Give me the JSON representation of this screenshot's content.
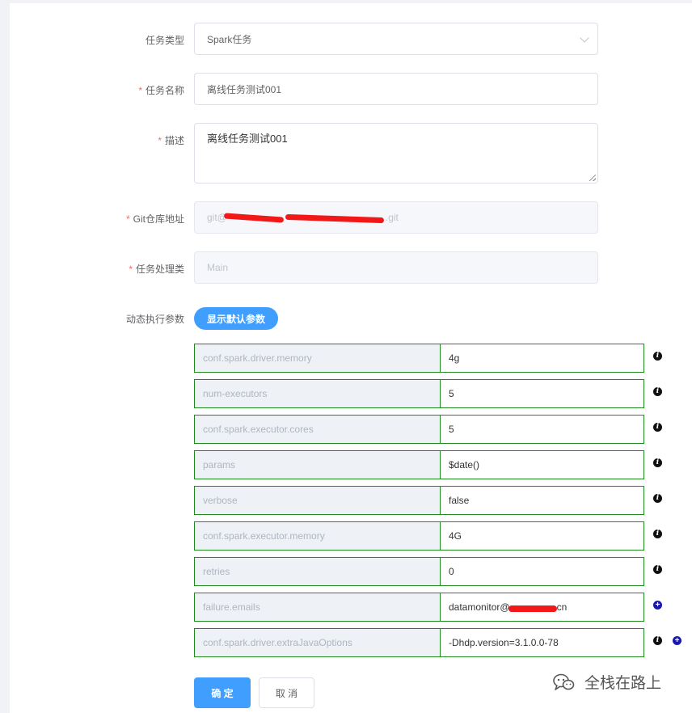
{
  "form": {
    "task_type": {
      "label": "任务类型",
      "value": "Spark任务"
    },
    "task_name": {
      "label": "任务名称",
      "value": "离线任务测试001"
    },
    "description": {
      "label": "描述",
      "value": "离线任务测试001"
    },
    "git_repo": {
      "label": "Git仓库地址",
      "value_start": "git@",
      "value_end": ".git"
    },
    "handler_class": {
      "label": "任务处理类",
      "value": "Main"
    },
    "dynamic_params": {
      "label": "动态执行参数",
      "show_defaults_button": "显示默认参数"
    }
  },
  "params": [
    {
      "key": "conf.spark.driver.memory",
      "value": "4g"
    },
    {
      "key": "num-executors",
      "value": "5"
    },
    {
      "key": "conf.spark.executor.cores",
      "value": "5"
    },
    {
      "key": "params",
      "value": "$date()"
    },
    {
      "key": "verbose",
      "value": "false"
    },
    {
      "key": "conf.spark.executor.memory",
      "value": "4G"
    },
    {
      "key": "retries",
      "value": "0"
    },
    {
      "key": "failure.emails",
      "value_start": "datamonitor@",
      "value_end": "cn"
    },
    {
      "key": "conf.spark.driver.extraJavaOptions",
      "value": "-Dhdp.version=3.1.0.0-78"
    }
  ],
  "icons": {
    "info": "i",
    "add": "+"
  },
  "actions": {
    "confirm": "确 定",
    "cancel": "取 消"
  },
  "watermark": {
    "text": "全栈在路上"
  },
  "colors": {
    "primary": "#409eff",
    "param_border": "#1f8b1f",
    "required": "#f56c6c",
    "redaction": "#f21818"
  }
}
